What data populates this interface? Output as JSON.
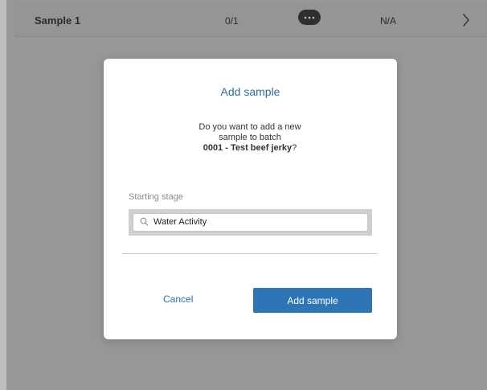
{
  "sample_row": {
    "name": "Sample 1",
    "count": "0/1",
    "more_icon": "ellipsis-icon",
    "status": "N/A",
    "chevron_icon": "chevron-right-icon"
  },
  "dialog": {
    "title": "Add sample",
    "message_line1": "Do you want to add a new",
    "message_line2": "sample to batch",
    "batch_name": "0001 - Test beef jerky",
    "message_suffix": "?",
    "stage_label": "Starting stage",
    "stage_value": "Water Activity",
    "stage_icon": "search-icon",
    "cancel_label": "Cancel",
    "confirm_label": "Add sample"
  },
  "colors": {
    "accent": "#2e75b6",
    "link": "#2f6ea5",
    "overlay": "#979797"
  }
}
